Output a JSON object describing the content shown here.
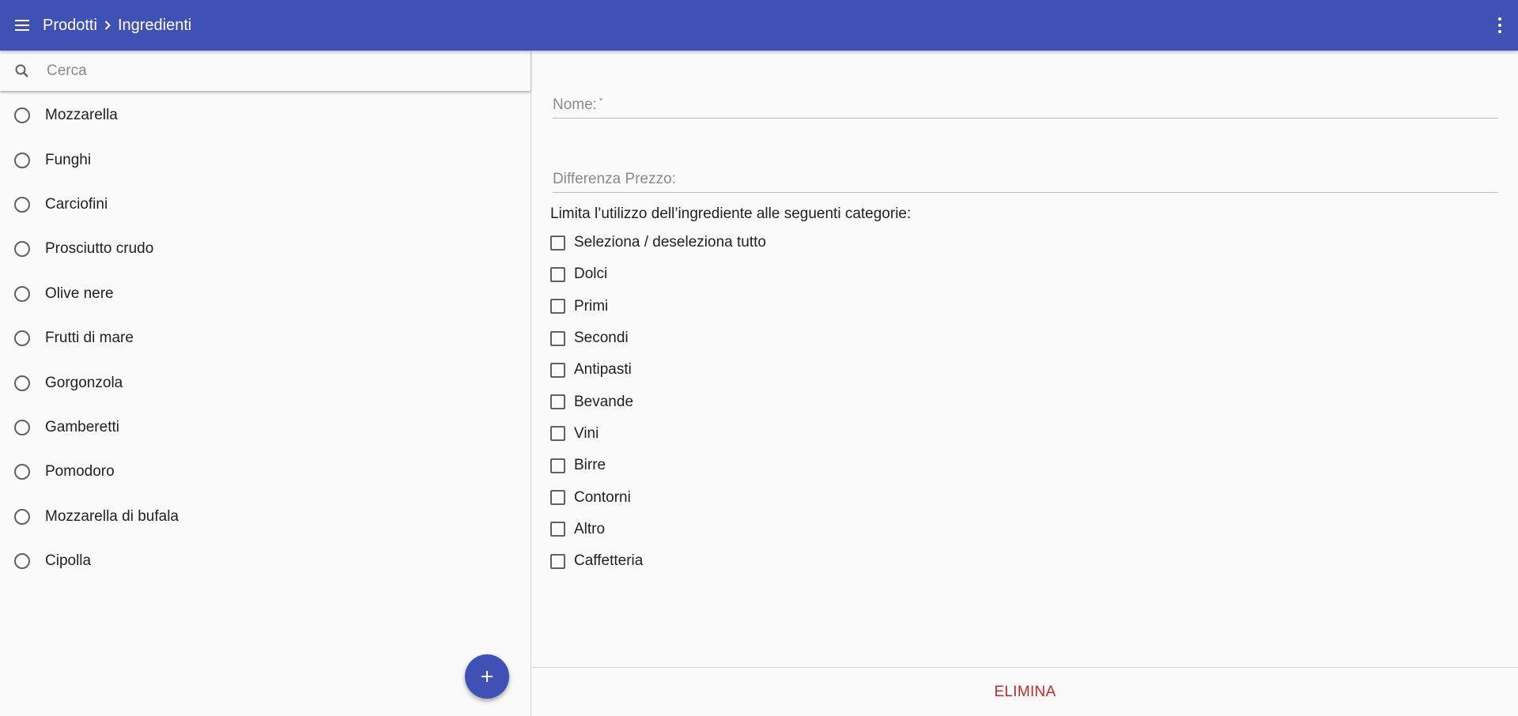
{
  "header": {
    "breadcrumb": [
      "Prodotti",
      "Ingredienti"
    ],
    "bar_color": "#3f51b5",
    "menu_icon": "hamburger-menu-icon",
    "more_icon": "more-vertical-icon"
  },
  "search": {
    "placeholder": "Cerca",
    "icon": "search-icon"
  },
  "ingredients": [
    "Mozzarella",
    "Funghi",
    "Carciofini",
    "Prosciutto crudo",
    "Olive nere",
    "Frutti di mare",
    "Gorgonzola",
    "Gamberetti",
    "Pomodoro",
    "Mozzarella di bufala",
    "Cipolla"
  ],
  "fab": {
    "icon": "plus-icon",
    "color": "#3f51b5"
  },
  "form": {
    "name_label": "Nome:",
    "name_required_mark": "*",
    "price_label": "Differenza Prezzo:",
    "categories_title": "Limita l’utilizzo dell’ingrediente alle seguenti categorie:",
    "categories": [
      "Seleziona / deseleziona tutto",
      "Dolci",
      "Primi",
      "Secondi",
      "Antipasti",
      "Bevande",
      "Vini",
      "Birre",
      "Contorni",
      "Altro",
      "Caffetteria"
    ]
  },
  "actions": {
    "delete_label": "ELIMINA",
    "delete_color": "#c62828"
  }
}
